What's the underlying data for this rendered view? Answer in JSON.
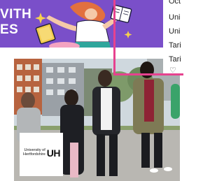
{
  "banner": {
    "line1": "VITH",
    "line2": "ES"
  },
  "dropdown": {
    "items": [
      "Oct",
      "Uni",
      "Uni",
      "Tari",
      "Tari"
    ],
    "heart_icon": "heart-icon"
  },
  "logo": {
    "small_text": "University of Hertfordshire",
    "mark": "UH"
  },
  "colors": {
    "banner_purple": "#7a4fc9",
    "frame_pink": "#e6428f"
  }
}
